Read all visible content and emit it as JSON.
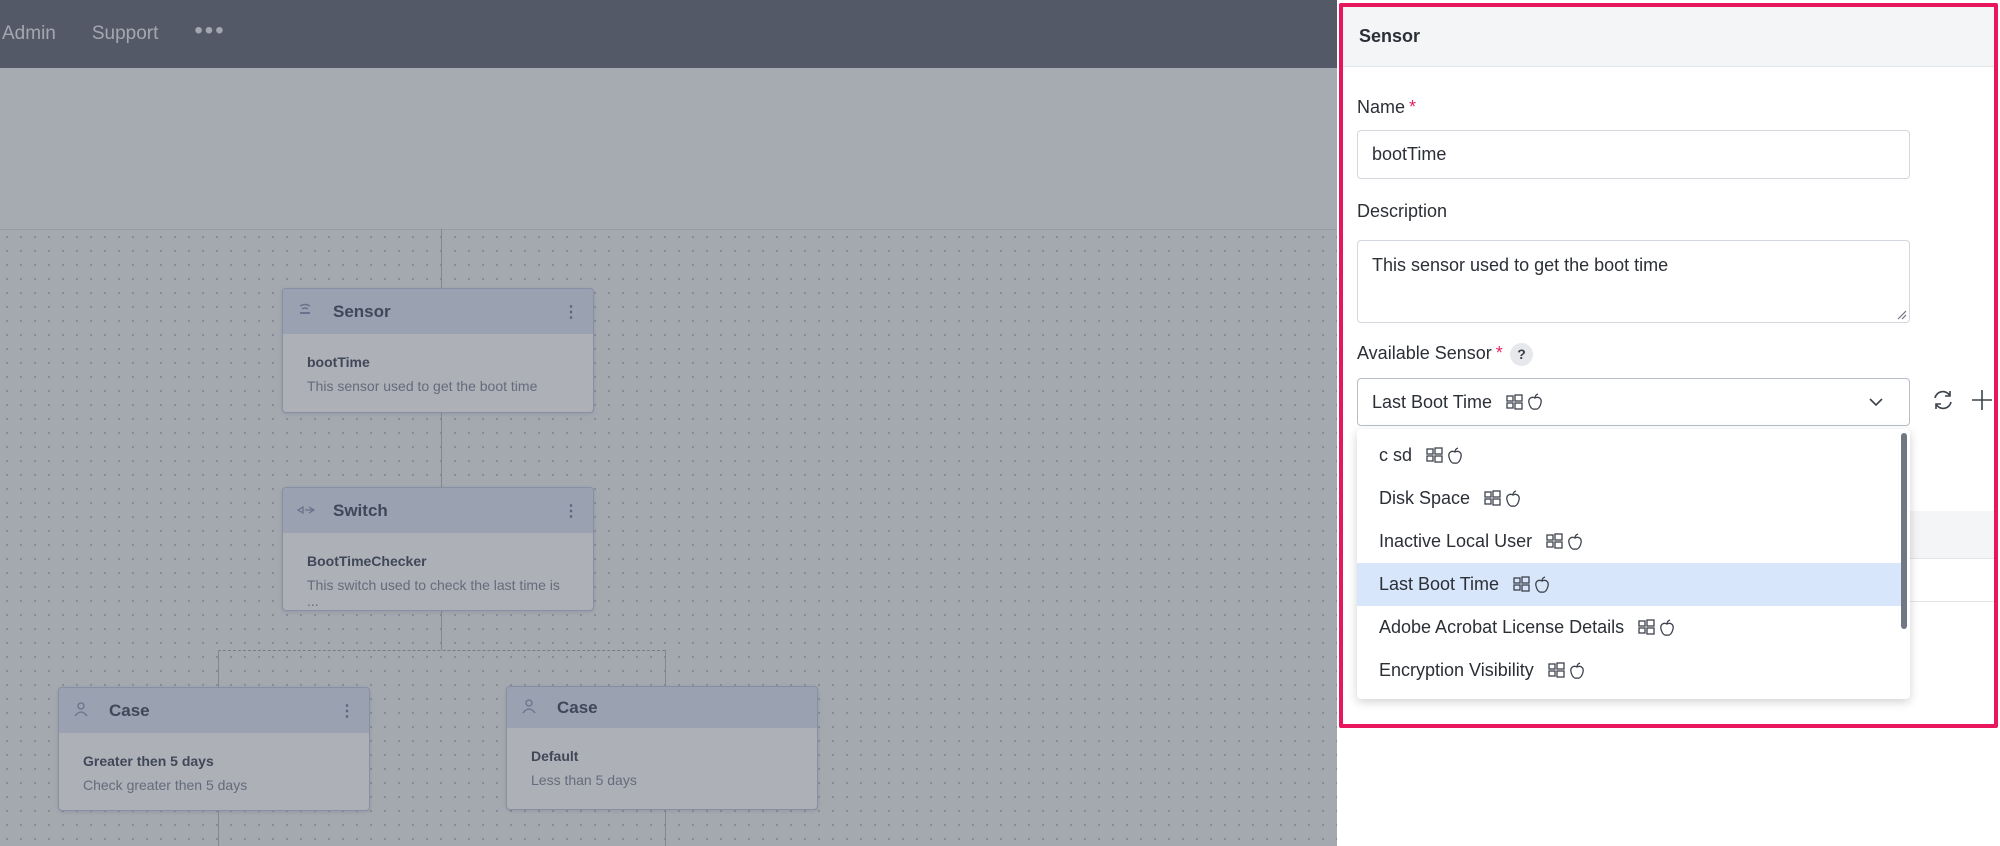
{
  "topbar": {
    "nav": [
      "Admin",
      "Support"
    ],
    "more": "•••"
  },
  "nodes": {
    "sensor": {
      "title": "Sensor",
      "name": "bootTime",
      "description": "This sensor used to get the boot time"
    },
    "switch": {
      "title": "Switch",
      "name": "BootTimeChecker",
      "description": "This switch used to check the last time is ..."
    },
    "case1": {
      "title": "Case",
      "name": "Greater then 5 days",
      "description": "Check greater then 5 days"
    },
    "case2": {
      "title": "Case",
      "name": "Default",
      "description": "Less than 5 days"
    },
    "menu_glyph": "⋮"
  },
  "panel": {
    "title": "Sensor",
    "name_label": "Name",
    "name_value": "bootTime",
    "description_label": "Description",
    "description_value": "This sensor used to get the boot time",
    "available_label": "Available Sensor",
    "required_mark": "*",
    "help": "?",
    "selected_value": "Last Boot Time",
    "options": [
      "c sd",
      "Disk Space",
      "Inactive Local User",
      "Last Boot Time",
      "Adobe Acrobat License Details",
      "Encryption Visibility"
    ],
    "selected_index": 3,
    "highlight_color": "#e8175d",
    "accent_selection": "#d8e6fb"
  },
  "icons": {
    "os": [
      "windows-icon",
      "apple-icon"
    ],
    "actions": [
      "refresh-icon",
      "plus-icon",
      "chevron-down-icon"
    ]
  }
}
